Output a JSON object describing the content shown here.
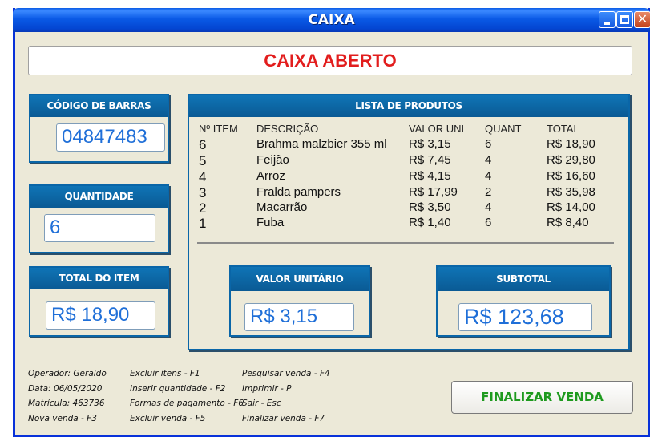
{
  "window": {
    "title": "CAIXA"
  },
  "status": {
    "text": "CAIXA ABERTO"
  },
  "barcode": {
    "label": "CÓDIGO DE BARRAS",
    "value": "04847483"
  },
  "quantity": {
    "label": "QUANTIDADE",
    "value": "6"
  },
  "item_total": {
    "label": "TOTAL DO ITEM",
    "value": "R$ 18,90"
  },
  "product_list": {
    "label": "LISTA DE PRODUTOS",
    "columns": [
      "Nº ITEM",
      "DESCRIÇÃO",
      "VALOR UNI",
      "QUANT",
      "TOTAL"
    ],
    "rows": [
      [
        "6",
        "Brahma malzbier 355 ml",
        "R$ 3,15",
        "6",
        "R$ 18,90"
      ],
      [
        "5",
        "Feijão",
        "R$ 7,45",
        "4",
        "R$ 29,80"
      ],
      [
        "4",
        "Arroz",
        "R$ 4,15",
        "4",
        "R$ 16,60"
      ],
      [
        "3",
        "Fralda pampers",
        "R$ 17,99",
        "2",
        "R$ 35,98"
      ],
      [
        "2",
        "Macarrão",
        "R$ 3,50",
        "4",
        "R$ 14,00"
      ],
      [
        "1",
        "Fuba",
        "R$ 1,40",
        "6",
        "R$ 8,40"
      ]
    ]
  },
  "unit_value": {
    "label": "VALOR UNITÁRIO",
    "value": "R$ 3,15"
  },
  "subtotal": {
    "label": "SUBTOTAL",
    "value": "R$ 123,68"
  },
  "footer": {
    "info": [
      "Operador: Geraldo",
      "Data: 06/05/2020",
      "Matrícula: 463736",
      "Nova venda - F3"
    ],
    "shortcuts_a": [
      "Excluir itens - F1",
      "Inserir quantidade - F2",
      "Formas de pagamento - F6",
      "Excluir venda - F5"
    ],
    "shortcuts_b": [
      "Pesquisar venda - F4",
      "Imprimir - P",
      "Sair - Esc",
      "Finalizar venda - F7"
    ]
  },
  "finalize_button": {
    "label": "FINALIZAR VENDA"
  },
  "colors": {
    "accent": "#0a66a8",
    "status_text": "#e21d1d",
    "value_text": "#1f6fd8",
    "finalize_text": "#1e9a1e"
  }
}
